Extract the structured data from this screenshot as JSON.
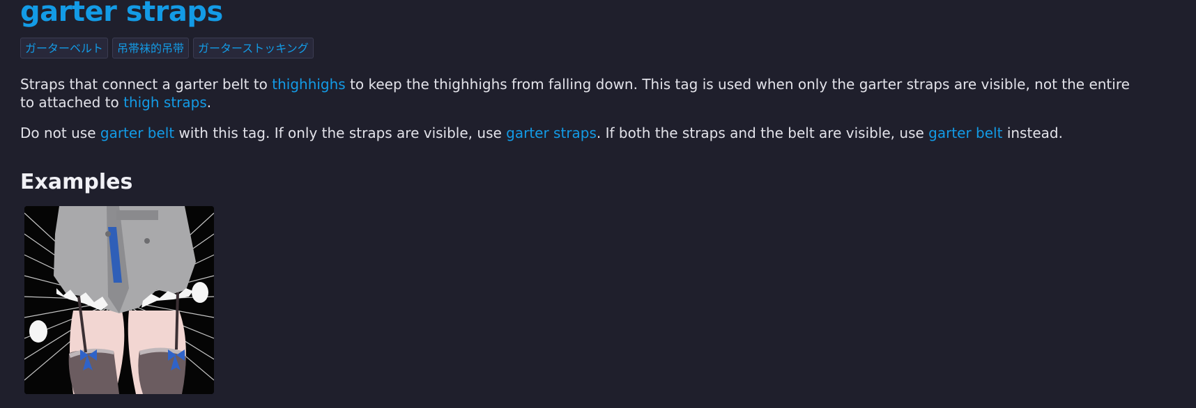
{
  "page": {
    "title": "garter straps"
  },
  "tags": [
    {
      "label": "ガーターベルト"
    },
    {
      "label": "吊帯袜的吊带"
    },
    {
      "label": "ガーターストッキング"
    }
  ],
  "description": {
    "p1": {
      "t1": "Straps that connect a garter belt to ",
      "link1": "thighhighs",
      "t2": " to keep the thighhighs from falling down. This tag is used when only the garter straps are visible, not the entire",
      "t3": "to attached to ",
      "link2": "thigh straps",
      "t4": "."
    },
    "p2": {
      "t1": "Do not use ",
      "link1": "garter belt",
      "t2": " with this tag. If only the straps are visible, use ",
      "link2": "garter straps",
      "t3": ". If both the straps and the belt are visible, use ",
      "link3": "garter belt",
      "t4": " instead."
    }
  },
  "examples": {
    "heading": "Examples"
  },
  "colors": {
    "background": "#1f1f2c",
    "link": "#139be6",
    "text": "#e3e3ea"
  }
}
